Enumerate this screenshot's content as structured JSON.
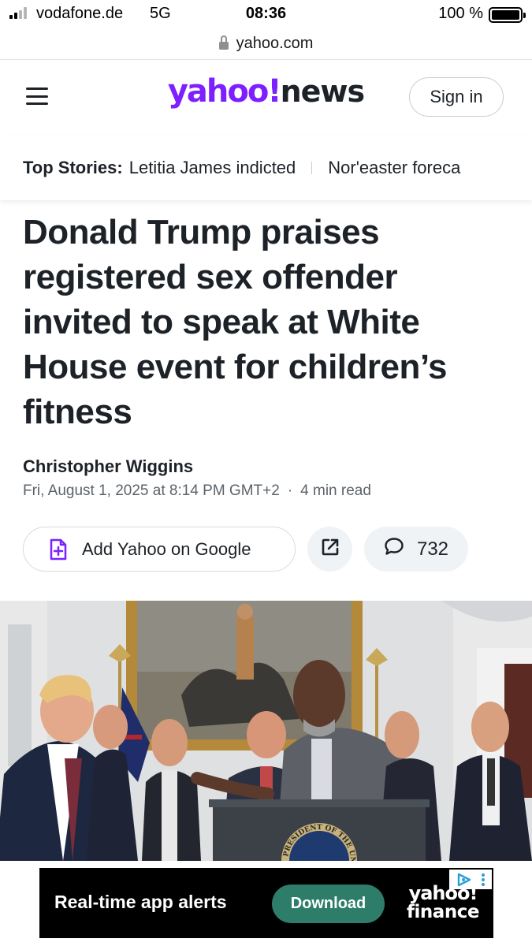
{
  "status_bar": {
    "carrier": "vodafone.de",
    "network": "5G",
    "time": "08:36",
    "battery": "100 %",
    "battery_level": 1.0
  },
  "browser": {
    "url": "yahoo.com",
    "lock_icon": "lock-icon"
  },
  "header": {
    "logo_yahoo": "yahoo!",
    "logo_news": "news",
    "sign_in": "Sign in",
    "menu_icon": "hamburger-menu-icon",
    "brand_color": "#7e1fff"
  },
  "top_stories": {
    "label": "Top Stories:",
    "items": [
      "Letitia James indicted",
      "Nor'easter foreca"
    ]
  },
  "article": {
    "headline": "Donald Trump praises registered sex offender invited to speak at White House event for children’s fitness",
    "author": "Christopher Wiggins",
    "date": "Fri, August 1, 2025 at 8:14 PM GMT+2",
    "separator": "·",
    "read_time": "4 min read"
  },
  "actions": {
    "add_google": "Add Yahoo on Google",
    "add_google_icon": "document-plus-icon",
    "share_icon": "share-external-icon",
    "comment_icon": "comment-bubble-icon",
    "comment_count": "732",
    "accent_color": "#7e1fff"
  },
  "photo": {
    "seal_text": "PRESIDENT OF THE UNITED"
  },
  "ad": {
    "text": "Real-time app alerts",
    "button": "Download",
    "brand_line1": "yahoo!",
    "brand_line2": "finance",
    "button_color": "#2e7d6b"
  }
}
